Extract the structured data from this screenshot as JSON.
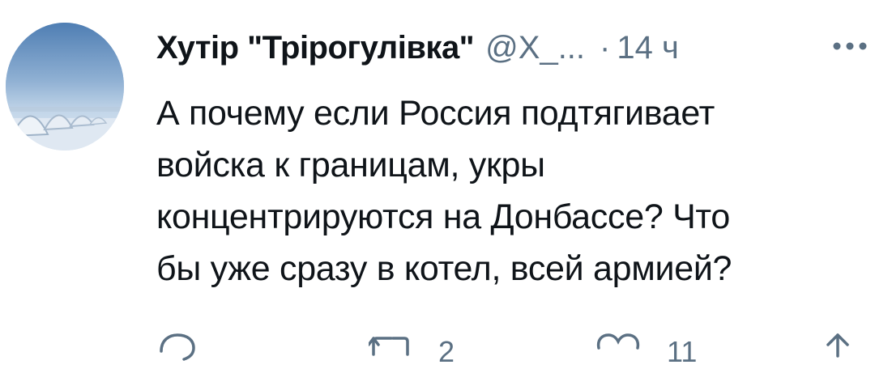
{
  "tweet": {
    "display_name": "Хутір \"Трірогулівка\"",
    "handle": "@Х_...",
    "separator": "·",
    "time": "14 ч",
    "text_lines": [
      "А почему если Россия подтягивает",
      "войска к границам, укры",
      "концентрируются на Донбассе? Что",
      "бы уже сразу в котел, всей армией?"
    ]
  },
  "actions": {
    "reply_icon": "reply-icon",
    "retweet_icon": "retweet-icon",
    "retweet_count": "2",
    "like_icon": "heart-icon",
    "like_count": "11",
    "share_icon": "share-icon"
  },
  "colors": {
    "text": "#0f1419",
    "secondary": "#5b7083"
  }
}
